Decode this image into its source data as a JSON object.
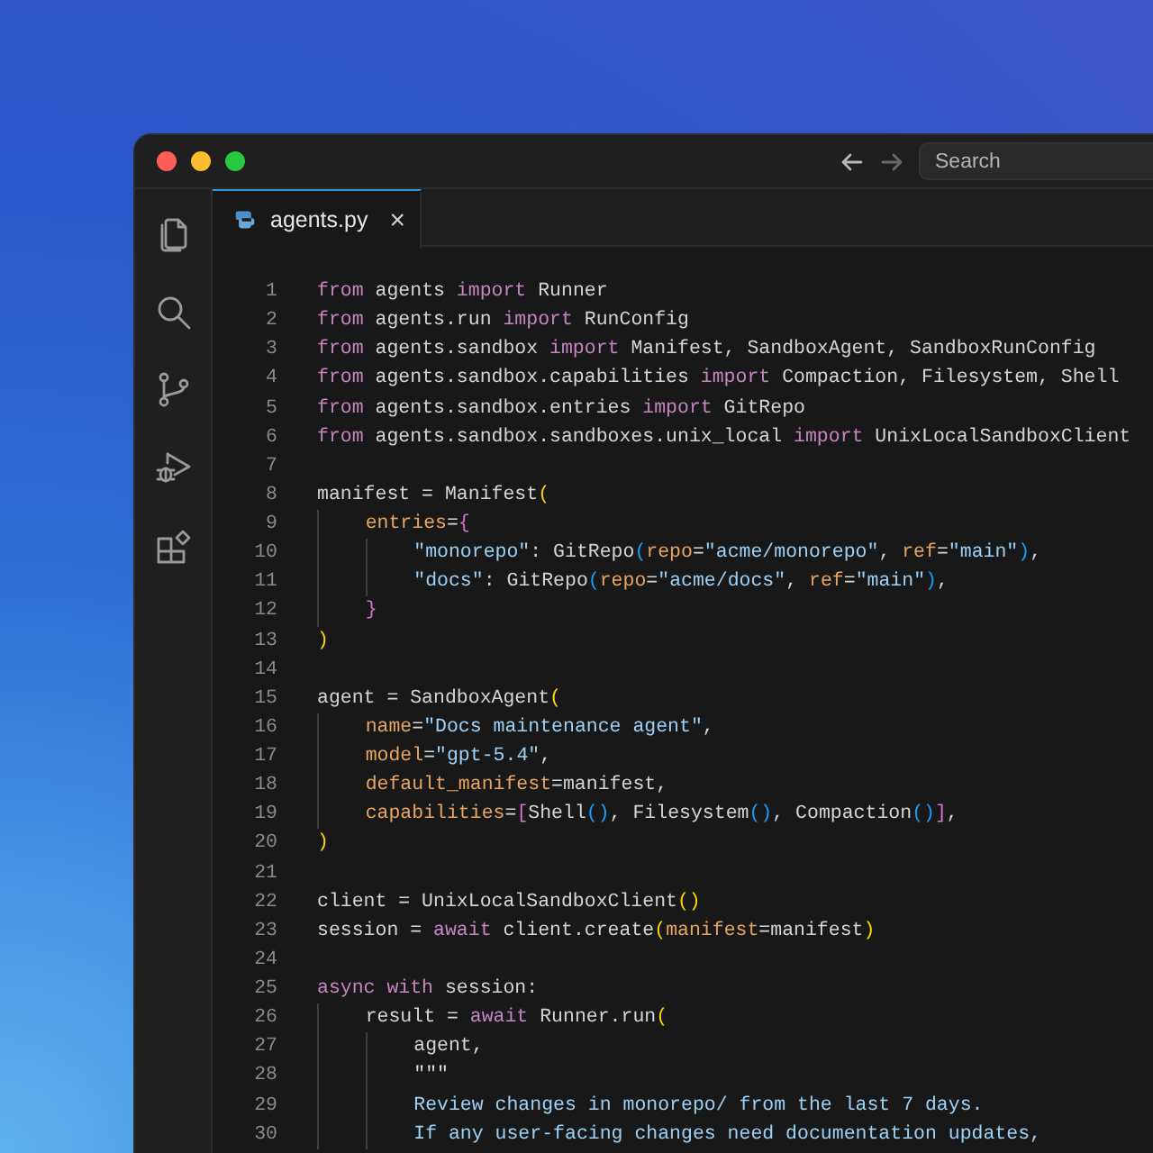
{
  "window": {
    "search": {
      "placeholder": "Search"
    }
  },
  "tabs": [
    {
      "label": "agents.py",
      "selected": true,
      "close": "×"
    }
  ],
  "activity_bar": [
    {
      "kind": "files",
      "selected": false
    },
    {
      "kind": "search",
      "selected": false
    },
    {
      "kind": "source-control",
      "selected": false
    },
    {
      "kind": "run-debug",
      "selected": false
    },
    {
      "kind": "extensions",
      "selected": false
    }
  ],
  "editor": {
    "lines": [
      {
        "number": "1",
        "tokens": [
          {
            "kind": "keyword",
            "text": "from"
          },
          {
            "kind": "plain",
            "text": " agents "
          },
          {
            "kind": "keyword",
            "text": "import"
          },
          {
            "kind": "plain",
            "text": " Runner"
          }
        ]
      },
      {
        "number": "2",
        "tokens": [
          {
            "kind": "keyword",
            "text": "from"
          },
          {
            "kind": "plain",
            "text": " agents.run "
          },
          {
            "kind": "keyword",
            "text": "import"
          },
          {
            "kind": "plain",
            "text": " RunConfig"
          }
        ]
      },
      {
        "number": "3",
        "tokens": [
          {
            "kind": "keyword",
            "text": "from"
          },
          {
            "kind": "plain",
            "text": " agents.sandbox "
          },
          {
            "kind": "keyword",
            "text": "import"
          },
          {
            "kind": "plain",
            "text": " Manifest, SandboxAgent, SandboxRunConfig"
          }
        ]
      },
      {
        "number": "4",
        "tokens": [
          {
            "kind": "keyword",
            "text": "from"
          },
          {
            "kind": "plain",
            "text": " agents.sandbox.capabilities "
          },
          {
            "kind": "keyword",
            "text": "import"
          },
          {
            "kind": "plain",
            "text": " Compaction, Filesystem, Shell"
          }
        ]
      },
      {
        "number": "5",
        "tokens": [
          {
            "kind": "keyword",
            "text": "from"
          },
          {
            "kind": "plain",
            "text": " agents.sandbox.entries "
          },
          {
            "kind": "keyword",
            "text": "import"
          },
          {
            "kind": "plain",
            "text": " GitRepo"
          }
        ]
      },
      {
        "number": "6",
        "tokens": [
          {
            "kind": "keyword",
            "text": "from"
          },
          {
            "kind": "plain",
            "text": " agents.sandbox.sandboxes.unix_local "
          },
          {
            "kind": "keyword",
            "text": "import"
          },
          {
            "kind": "plain",
            "text": " UnixLocalSandboxClient"
          }
        ]
      },
      {
        "number": "7"
      },
      {
        "number": "8",
        "tokens": [
          {
            "kind": "plain",
            "text": "manifest = Manifest"
          },
          {
            "kind": "bracket1",
            "text": "("
          }
        ]
      },
      {
        "number": "9",
        "tokens": [
          {
            "kind": "param",
            "text": "    entries"
          },
          {
            "kind": "plain",
            "text": "="
          },
          {
            "kind": "bracket2",
            "text": "{"
          }
        ]
      },
      {
        "number": "10",
        "tokens": [
          {
            "kind": "string",
            "text": "        \"monorepo\""
          },
          {
            "kind": "plain",
            "text": ": GitRepo"
          },
          {
            "kind": "bracket3",
            "text": "("
          },
          {
            "kind": "param",
            "text": "repo"
          },
          {
            "kind": "plain",
            "text": "="
          },
          {
            "kind": "string",
            "text": "\"acme/monorepo\""
          },
          {
            "kind": "plain",
            "text": ", "
          },
          {
            "kind": "param",
            "text": "ref"
          },
          {
            "kind": "plain",
            "text": "="
          },
          {
            "kind": "string",
            "text": "\"main\""
          },
          {
            "kind": "bracket3",
            "text": ")"
          },
          {
            "kind": "plain",
            "text": ","
          }
        ]
      },
      {
        "number": "11",
        "tokens": [
          {
            "kind": "string",
            "text": "        \"docs\""
          },
          {
            "kind": "plain",
            "text": ": GitRepo"
          },
          {
            "kind": "bracket3",
            "text": "("
          },
          {
            "kind": "param",
            "text": "repo"
          },
          {
            "kind": "plain",
            "text": "="
          },
          {
            "kind": "string",
            "text": "\"acme/docs\""
          },
          {
            "kind": "plain",
            "text": ", "
          },
          {
            "kind": "param",
            "text": "ref"
          },
          {
            "kind": "plain",
            "text": "="
          },
          {
            "kind": "string",
            "text": "\"main\""
          },
          {
            "kind": "bracket3",
            "text": ")"
          },
          {
            "kind": "plain",
            "text": ","
          }
        ]
      },
      {
        "number": "12",
        "tokens": [
          {
            "kind": "bracket2",
            "text": "    }"
          }
        ]
      },
      {
        "number": "13",
        "tokens": [
          {
            "kind": "bracket1",
            "text": ")"
          }
        ]
      },
      {
        "number": "14"
      },
      {
        "number": "15",
        "tokens": [
          {
            "kind": "plain",
            "text": "agent = SandboxAgent"
          },
          {
            "kind": "bracket1",
            "text": "("
          }
        ]
      },
      {
        "number": "16",
        "tokens": [
          {
            "kind": "param",
            "text": "    name"
          },
          {
            "kind": "plain",
            "text": "="
          },
          {
            "kind": "string",
            "text": "\"Docs maintenance agent\""
          },
          {
            "kind": "plain",
            "text": ","
          }
        ]
      },
      {
        "number": "17",
        "tokens": [
          {
            "kind": "param",
            "text": "    model"
          },
          {
            "kind": "plain",
            "text": "="
          },
          {
            "kind": "string",
            "text": "\"gpt-5.4\""
          },
          {
            "kind": "plain",
            "text": ","
          }
        ]
      },
      {
        "number": "18",
        "tokens": [
          {
            "kind": "param",
            "text": "    default_manifest"
          },
          {
            "kind": "plain",
            "text": "=manifest,"
          }
        ]
      },
      {
        "number": "19",
        "tokens": [
          {
            "kind": "param",
            "text": "    capabilities"
          },
          {
            "kind": "plain",
            "text": "="
          },
          {
            "kind": "bracket2",
            "text": "["
          },
          {
            "kind": "plain",
            "text": "Shell"
          },
          {
            "kind": "bracket3",
            "text": "()"
          },
          {
            "kind": "plain",
            "text": ", Filesystem"
          },
          {
            "kind": "bracket3",
            "text": "()"
          },
          {
            "kind": "plain",
            "text": ", Compaction"
          },
          {
            "kind": "bracket3",
            "text": "()"
          },
          {
            "kind": "bracket2",
            "text": "]"
          },
          {
            "kind": "plain",
            "text": ","
          }
        ]
      },
      {
        "number": "20",
        "tokens": [
          {
            "kind": "bracket1",
            "text": ")"
          }
        ]
      },
      {
        "number": "21"
      },
      {
        "number": "22",
        "tokens": [
          {
            "kind": "plain",
            "text": "client = UnixLocalSandboxClient"
          },
          {
            "kind": "bracket1",
            "text": "()"
          }
        ]
      },
      {
        "number": "23",
        "tokens": [
          {
            "kind": "plain",
            "text": "session = "
          },
          {
            "kind": "keyword",
            "text": "await"
          },
          {
            "kind": "plain",
            "text": " client.create"
          },
          {
            "kind": "bracket1",
            "text": "("
          },
          {
            "kind": "param",
            "text": "manifest"
          },
          {
            "kind": "plain",
            "text": "=manifest"
          },
          {
            "kind": "bracket1",
            "text": ")"
          }
        ]
      },
      {
        "number": "24"
      },
      {
        "number": "25",
        "tokens": [
          {
            "kind": "keyword",
            "text": "async with"
          },
          {
            "kind": "plain",
            "text": " session:"
          }
        ]
      },
      {
        "number": "26",
        "tokens": [
          {
            "kind": "plain",
            "text": "    result = "
          },
          {
            "kind": "keyword",
            "text": "await"
          },
          {
            "kind": "plain",
            "text": " Runner.run"
          },
          {
            "kind": "bracket1",
            "text": "("
          }
        ]
      },
      {
        "number": "27",
        "tokens": [
          {
            "kind": "plain",
            "text": "        agent,"
          }
        ]
      },
      {
        "number": "28",
        "tokens": [
          {
            "kind": "docstring",
            "text": "        \"\"\""
          }
        ]
      },
      {
        "number": "29",
        "tokens": [
          {
            "kind": "string",
            "text": "        Review changes in monorepo/ from the last 7 days."
          }
        ]
      },
      {
        "number": "30",
        "tokens": [
          {
            "kind": "string",
            "text": "        If any user-facing changes need documentation updates,"
          }
        ]
      }
    ]
  }
}
